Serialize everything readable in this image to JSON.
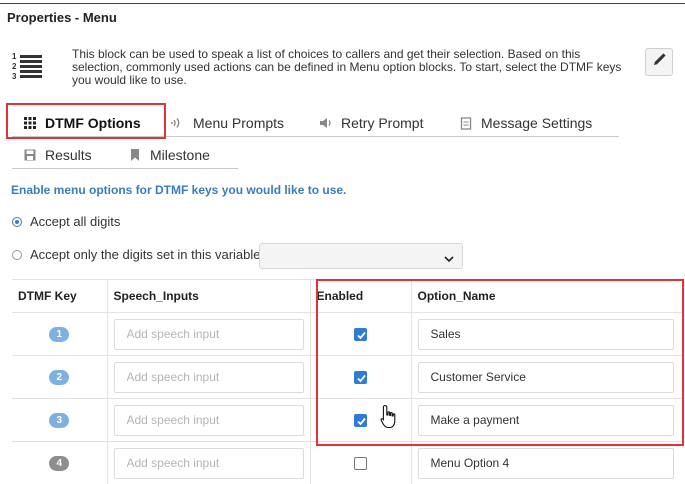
{
  "panel": {
    "title": "Properties - Menu"
  },
  "block": {
    "icon": "numbered-list-icon",
    "description": "This block can be used to speak a list of choices to callers and get their selection. Based on this selection, commonly used actions can be defined in Menu option blocks. To start, select the DTMF keys you would like to use.",
    "edit_icon": "pencil-icon"
  },
  "tabs": [
    {
      "label": "DTMF Options",
      "icon": "grid-icon",
      "active": true
    },
    {
      "label": "Menu Prompts",
      "icon": "speaker-waves-icon",
      "active": false
    },
    {
      "label": "Retry Prompt",
      "icon": "volume-icon",
      "active": false
    },
    {
      "label": "Message Settings",
      "icon": "document-icon",
      "active": false
    },
    {
      "label": "Results",
      "icon": "save-icon",
      "active": false
    },
    {
      "label": "Milestone",
      "icon": "bookmark-icon",
      "active": false
    }
  ],
  "info_text": "Enable menu options for DTMF keys you would like to use.",
  "digit_mode": {
    "accept_all": "Accept all digits",
    "accept_variable": "Accept only the digits set in this variable:",
    "selected": "accept_all",
    "variable_value": ""
  },
  "table": {
    "headers": [
      "DTMF Key",
      "Speech_Inputs",
      "Enabled",
      "Option_Name"
    ],
    "speech_placeholder": "Add speech input",
    "rows": [
      {
        "key": "1",
        "enabled": true,
        "option_name": "Sales"
      },
      {
        "key": "2",
        "enabled": true,
        "option_name": "Customer Service"
      },
      {
        "key": "3",
        "enabled": true,
        "option_name": "Make a payment"
      },
      {
        "key": "4",
        "enabled": false,
        "option_name": "Menu Option 4"
      }
    ]
  },
  "colors": {
    "accent": "#3b7bbf",
    "highlight": "#e0333a",
    "checkbox": "#2f7bd8"
  }
}
